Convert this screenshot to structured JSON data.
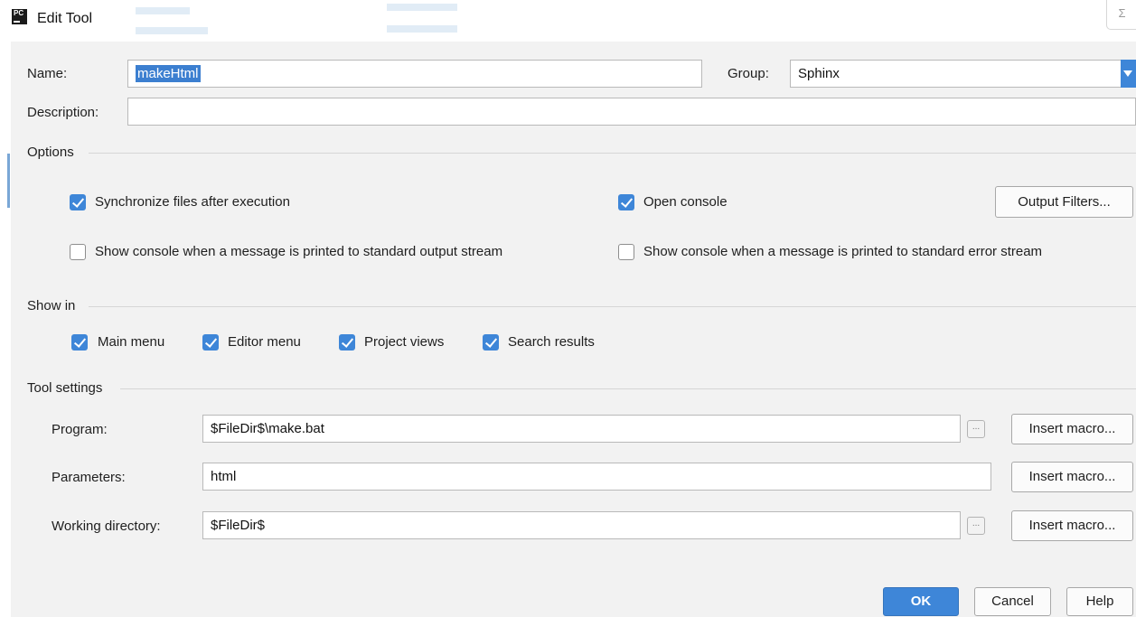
{
  "window": {
    "title": "Edit Tool",
    "app_icon": "PC",
    "close_glyph": "Σ"
  },
  "form": {
    "name_label": "Name:",
    "name_value": "makeHtml",
    "group_label": "Group:",
    "group_value": "Sphinx",
    "description_label": "Description:",
    "description_value": ""
  },
  "options": {
    "title": "Options",
    "sync_files": {
      "label": "Synchronize files after execution",
      "checked": true
    },
    "open_console": {
      "label": "Open console",
      "checked": true
    },
    "output_filters_label": "Output Filters...",
    "show_console_stdout": {
      "label": "Show console when a message is printed to standard output stream",
      "checked": false
    },
    "show_console_stderr": {
      "label": "Show console when a message is printed to standard error stream",
      "checked": false
    }
  },
  "show_in": {
    "title": "Show in",
    "items": [
      {
        "label": "Main menu",
        "checked": true
      },
      {
        "label": "Editor menu",
        "checked": true
      },
      {
        "label": "Project views",
        "checked": true
      },
      {
        "label": "Search results",
        "checked": true
      }
    ]
  },
  "tool_settings": {
    "title": "Tool settings",
    "program_label": "Program:",
    "program_value": "$FileDir$\\make.bat",
    "parameters_label": "Parameters:",
    "parameters_value": "html",
    "working_dir_label": "Working directory:",
    "working_dir_value": "$FileDir$",
    "insert_macro_label": "Insert macro...",
    "browse_glyph": "..."
  },
  "footer": {
    "ok_label": "OK",
    "cancel_label": "Cancel",
    "help_label": "Help"
  },
  "colors": {
    "accent": "#3e86d8",
    "panel_bg": "#f2f2f2",
    "selection": "#3c7fd0"
  }
}
